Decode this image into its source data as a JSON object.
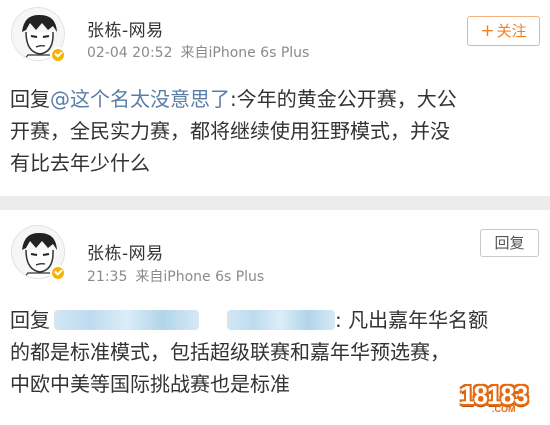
{
  "posts": [
    {
      "author": "张栋-网易",
      "time": "02-04 20:52",
      "source": "来自iPhone 6s Plus",
      "action_label": "关注",
      "reply_prefix": "回复",
      "mention": "@这个名太没意思了",
      "line1": ":今年的黄金公开赛，大公",
      "line2": "开赛，全民实力赛，都将继续使用狂野模式，并没",
      "line3": "有比去年少什么"
    },
    {
      "author": "张栋-网易",
      "time": "21:35",
      "source": "来自iPhone 6s Plus",
      "action_label": "回复",
      "reply_prefix": "回复",
      "line1_tail": ": 凡出嘉年华名额",
      "line2": "的都是标准模式，包括超级联赛和嘉年华预选赛，",
      "line3": "中欧中美等国际挑战赛也是标准"
    }
  ],
  "watermark": {
    "main": "18183",
    "sub": ".COM"
  },
  "colors": {
    "accent": "#f08221",
    "mention": "#5a7da8",
    "badge": "#f7b500"
  }
}
